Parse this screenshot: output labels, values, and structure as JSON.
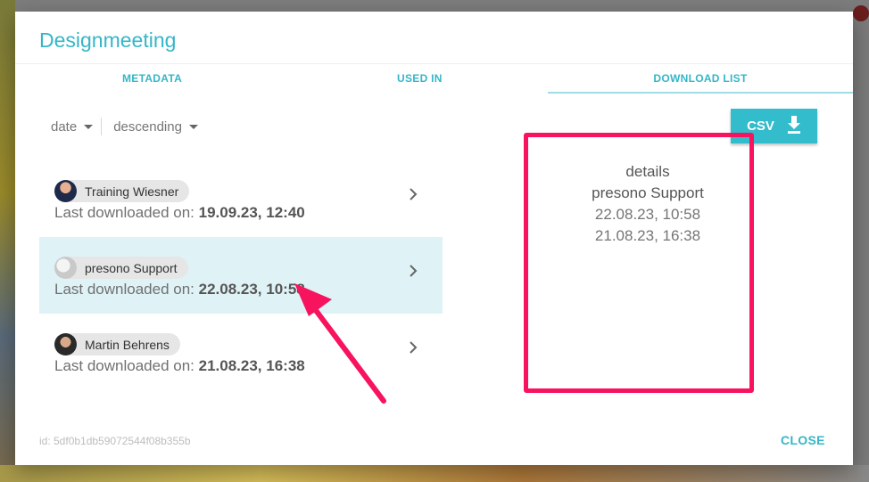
{
  "dialog": {
    "title": "Designmeeting",
    "tabs": [
      {
        "label": "METADATA"
      },
      {
        "label": "USED IN"
      },
      {
        "label": "DOWNLOAD LIST",
        "active": true
      }
    ],
    "sort": {
      "field": "date",
      "order": "descending"
    },
    "csv_button": {
      "label": "CSV",
      "icon": "download-icon"
    },
    "downloads": [
      {
        "user": "Training Wiesner",
        "prefix": "Last downloaded on: ",
        "date": "19.09.23, 12:40",
        "selected": false
      },
      {
        "user": "presono Support",
        "prefix": "Last downloaded on: ",
        "date": "22.08.23, 10:58",
        "selected": true
      },
      {
        "user": "Martin Behrens",
        "prefix": "Last downloaded on: ",
        "date": "21.08.23, 16:38",
        "selected": false
      }
    ],
    "details": {
      "title": "details",
      "user": "presono Support",
      "dates": [
        "22.08.23, 10:58",
        "21.08.23, 16:38"
      ]
    },
    "footer": {
      "id_text": "id: 5df0b1db59072544f08b355b",
      "close_label": "CLOSE"
    }
  },
  "colors": {
    "accent": "#35b6c8",
    "selected_row": "#dff2f6",
    "annotation": "#f7135e"
  }
}
